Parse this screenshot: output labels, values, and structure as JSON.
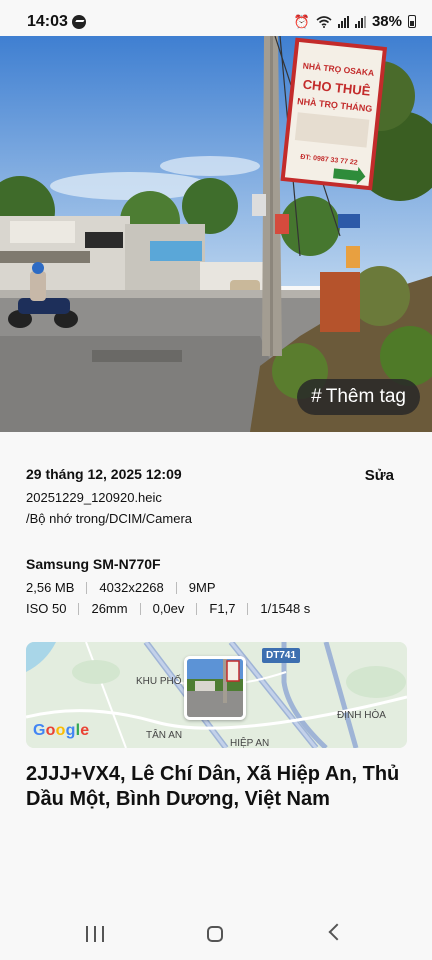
{
  "status_bar": {
    "time": "14:03",
    "battery": "38%",
    "icons": [
      "messenger-icon",
      "alarm-icon",
      "wifi-icon",
      "signal-icon",
      "battery-icon"
    ]
  },
  "photo": {
    "tag_button": {
      "icon": "#",
      "label": "Thêm tag"
    },
    "sign_lines": [
      "NHÀ TRỌ OSAKA",
      "CHO THUÊ",
      "NHÀ TRỌ THÁNG",
      "ĐT: 0987 33 77 22"
    ]
  },
  "details": {
    "datetime": "29 tháng 12, 2025 12:09",
    "edit_label": "Sửa",
    "filename": "20251229_120920.heic",
    "path": "/Bộ nhớ trong/DCIM/Camera",
    "device": "Samsung SM-N770F",
    "specs_row1": [
      "2,56 MB",
      "4032x2268",
      "9MP"
    ],
    "specs_row2": [
      "ISO 50",
      "26mm",
      "0,0ev",
      "F1,7",
      "1/1548 s"
    ]
  },
  "map": {
    "road_badge": "DT741",
    "labels": [
      "KHU PHỐ",
      "TÂN AN",
      "HIỆP AN",
      "ĐỊNH HÒA"
    ],
    "logo": "Google"
  },
  "address": "2JJJ+VX4, Lê Chí Dân, Xã Hiệp An, Thủ Dầu Một, Bình Dương, Việt Nam",
  "navbar": {
    "icons": [
      "recent-apps-icon",
      "home-icon",
      "back-icon"
    ]
  }
}
